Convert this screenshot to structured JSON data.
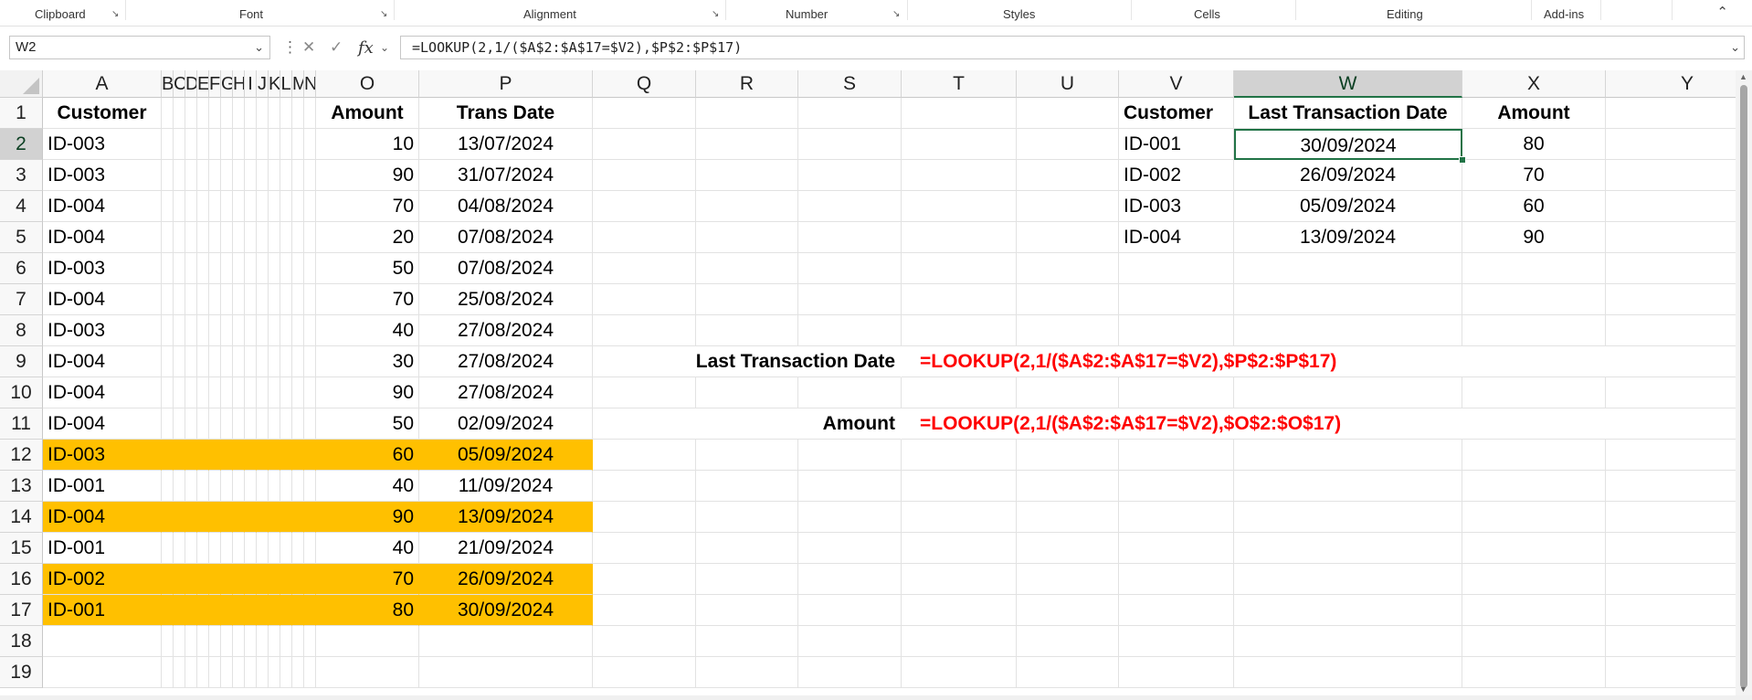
{
  "ribbon": {
    "groups": [
      "Clipboard",
      "Font",
      "Alignment",
      "Number",
      "Styles",
      "Cells",
      "Editing",
      "Add-ins"
    ],
    "collapse_icon": "chevron-up-icon"
  },
  "formula_bar": {
    "name_box": "W2",
    "fx_label": "fx",
    "formula": "=LOOKUP(2,1/($A$2:$A$17=$V2),$P$2:$P$17)"
  },
  "columns": [
    "A",
    "B",
    "C",
    "D",
    "E",
    "F",
    "G",
    "H",
    "I",
    "J",
    "K",
    "L",
    "M",
    "N",
    "O",
    "P",
    "Q",
    "R",
    "S",
    "T",
    "U",
    "V",
    "W",
    "X",
    "Y"
  ],
  "rows": [
    "1",
    "2",
    "3",
    "4",
    "5",
    "6",
    "7",
    "8",
    "9",
    "10",
    "11",
    "12",
    "13",
    "14",
    "15",
    "16",
    "17",
    "18",
    "19"
  ],
  "source_table": {
    "headers": {
      "customer": "Customer",
      "amount": "Amount",
      "date": "Trans Date"
    },
    "rows": [
      {
        "customer": "ID-003",
        "amount": "10",
        "date": "13/07/2024",
        "highlight": false
      },
      {
        "customer": "ID-003",
        "amount": "90",
        "date": "31/07/2024",
        "highlight": false
      },
      {
        "customer": "ID-004",
        "amount": "70",
        "date": "04/08/2024",
        "highlight": false
      },
      {
        "customer": "ID-004",
        "amount": "20",
        "date": "07/08/2024",
        "highlight": false
      },
      {
        "customer": "ID-003",
        "amount": "50",
        "date": "07/08/2024",
        "highlight": false
      },
      {
        "customer": "ID-004",
        "amount": "70",
        "date": "25/08/2024",
        "highlight": false
      },
      {
        "customer": "ID-003",
        "amount": "40",
        "date": "27/08/2024",
        "highlight": false
      },
      {
        "customer": "ID-004",
        "amount": "30",
        "date": "27/08/2024",
        "highlight": false
      },
      {
        "customer": "ID-004",
        "amount": "90",
        "date": "27/08/2024",
        "highlight": false
      },
      {
        "customer": "ID-004",
        "amount": "50",
        "date": "02/09/2024",
        "highlight": false
      },
      {
        "customer": "ID-003",
        "amount": "60",
        "date": "05/09/2024",
        "highlight": true
      },
      {
        "customer": "ID-001",
        "amount": "40",
        "date": "11/09/2024",
        "highlight": false
      },
      {
        "customer": "ID-004",
        "amount": "90",
        "date": "13/09/2024",
        "highlight": true
      },
      {
        "customer": "ID-001",
        "amount": "40",
        "date": "21/09/2024",
        "highlight": false
      },
      {
        "customer": "ID-002",
        "amount": "70",
        "date": "26/09/2024",
        "highlight": true
      },
      {
        "customer": "ID-001",
        "amount": "80",
        "date": "30/09/2024",
        "highlight": true
      }
    ]
  },
  "summary_table": {
    "headers": {
      "customer": "Customer",
      "last_date": "Last Transaction Date",
      "amount": "Amount"
    },
    "rows": [
      {
        "customer": "ID-001",
        "last_date": "30/09/2024",
        "amount": "80"
      },
      {
        "customer": "ID-002",
        "last_date": "26/09/2024",
        "amount": "70"
      },
      {
        "customer": "ID-003",
        "last_date": "05/09/2024",
        "amount": "60"
      },
      {
        "customer": "ID-004",
        "last_date": "13/09/2024",
        "amount": "90"
      }
    ]
  },
  "notes": {
    "date_label": "Last Transaction Date",
    "date_formula": "=LOOKUP(2,1/($A$2:$A$17=$V2),$P$2:$P$17)",
    "amount_label": "Amount",
    "amount_formula": "=LOOKUP(2,1/($A$2:$A$17=$V2),$O$2:$O$17)"
  },
  "active_cell": "W2",
  "colors": {
    "highlight": "#ffc000",
    "formula_text": "#ff0000",
    "accent": "#217346"
  }
}
